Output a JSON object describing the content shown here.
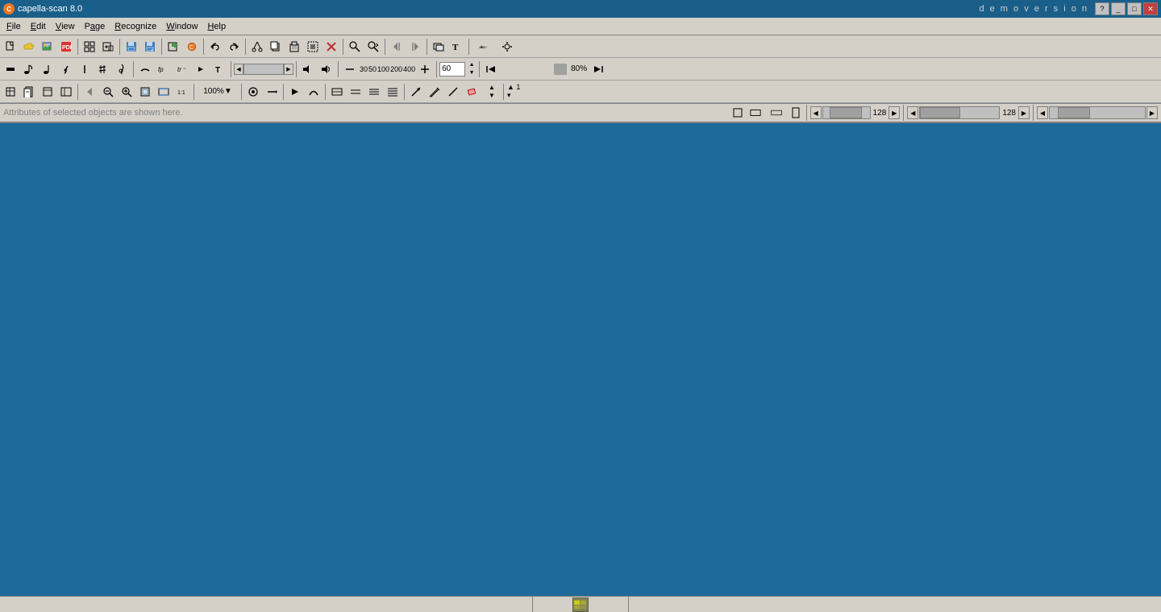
{
  "titleBar": {
    "appName": "capella-scan 8.0",
    "demoText": "d e m o   v e r s i o n",
    "icon": "C",
    "buttons": {
      "help": "?",
      "minimize": "_",
      "maximize": "□",
      "close": "✕"
    }
  },
  "menuBar": {
    "items": [
      {
        "label": "File",
        "underlineIndex": 0
      },
      {
        "label": "Edit",
        "underlineIndex": 0
      },
      {
        "label": "View",
        "underlineIndex": 0
      },
      {
        "label": "Page",
        "underlineIndex": 0
      },
      {
        "label": "Recognize",
        "underlineIndex": 0
      },
      {
        "label": "Window",
        "underlineIndex": 0
      },
      {
        "label": "Help",
        "underlineIndex": 0
      }
    ]
  },
  "toolbar": {
    "zoomValue": "60",
    "zoomPercent": "80%",
    "zoomSelect": "100%",
    "scrollValue1": "128",
    "scrollValue2": "128"
  },
  "attrBar": {
    "text": "Attributes of selected objects are shown here."
  },
  "statusBar": {
    "centerIcon": "⊞",
    "rightText": ""
  }
}
